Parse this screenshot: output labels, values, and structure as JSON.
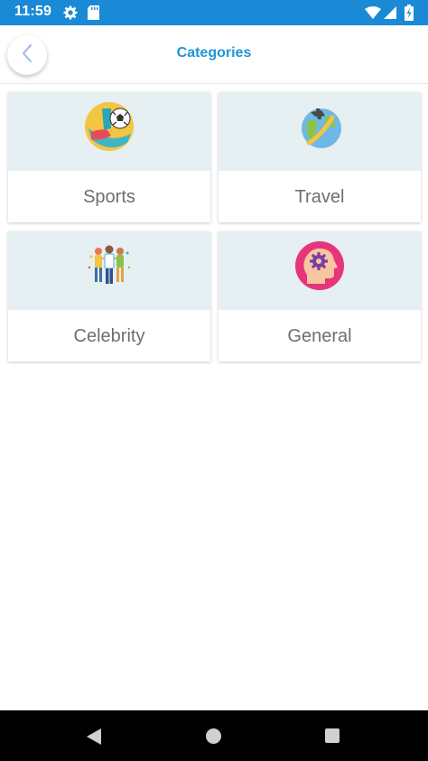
{
  "status_bar": {
    "time": "11:59",
    "icons": [
      "gear-icon",
      "sd-card-icon",
      "wifi-icon",
      "signal-icon",
      "battery-icon"
    ],
    "color": "#1b8ad6"
  },
  "app_bar": {
    "title": "Categories",
    "back_icon": "chevron-left-icon",
    "title_color": "#1e96d8"
  },
  "categories": [
    {
      "label": "Sports",
      "icon": "soccer-icon"
    },
    {
      "label": "Travel",
      "icon": "globe-plane-icon"
    },
    {
      "label": "Celebrity",
      "icon": "people-group-icon"
    },
    {
      "label": "General",
      "icon": "brain-gear-icon"
    }
  ],
  "nav_bar": {
    "icons": [
      "back-triangle-icon",
      "home-circle-icon",
      "recents-square-icon"
    ]
  }
}
